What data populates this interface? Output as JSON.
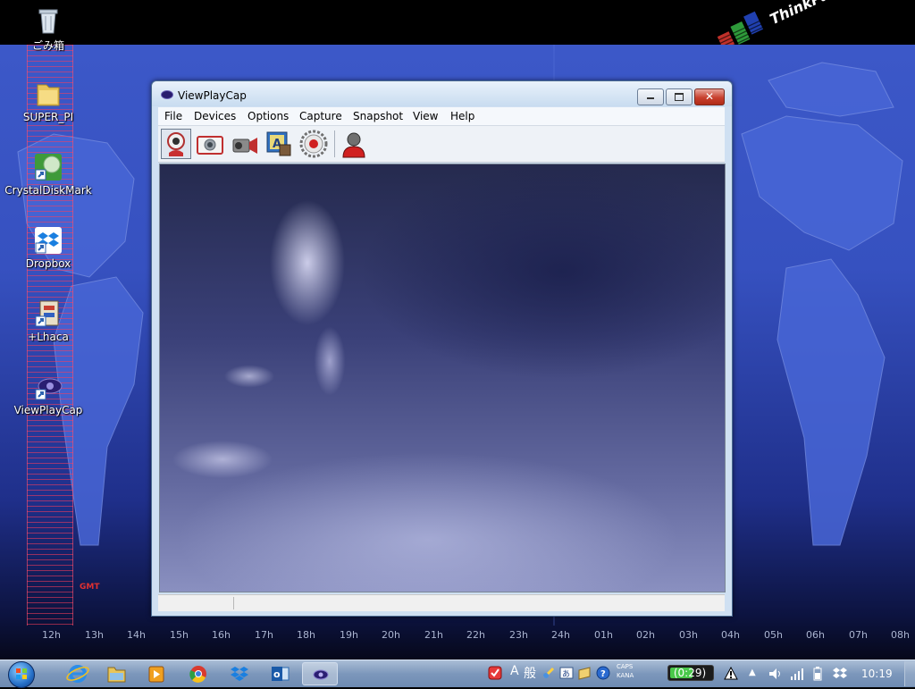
{
  "desktop": {
    "icons": [
      {
        "label": "ごみ箱",
        "icon": "recycle-bin-icon"
      },
      {
        "label": "SUPER_PI",
        "icon": "folder-icon"
      },
      {
        "label": "CrystalDiskMark",
        "icon": "crystaldiskmark-icon"
      },
      {
        "label": "Dropbox",
        "icon": "dropbox-icon"
      },
      {
        "label": "+Lhaca",
        "icon": "lhaca-icon"
      },
      {
        "label": "ViewPlayCap",
        "icon": "viewplaycap-icon"
      }
    ],
    "logo_text": "ThinkPad",
    "gmt_label": "GMT",
    "hours": [
      "12h",
      "13h",
      "14h",
      "15h",
      "16h",
      "17h",
      "18h",
      "19h",
      "20h",
      "21h",
      "22h",
      "23h",
      "24h",
      "01h",
      "02h",
      "03h",
      "04h",
      "05h",
      "06h",
      "07h",
      "08h"
    ]
  },
  "window": {
    "title": "ViewPlayCap",
    "menus": [
      "File",
      "Devices",
      "Options",
      "Capture",
      "Snapshot",
      "View",
      "Help"
    ],
    "toolbar": [
      {
        "name": "preview-webcam",
        "icon": "webcam-icon",
        "active": true
      },
      {
        "name": "snapshot-camera",
        "icon": "camera-icon",
        "active": false
      },
      {
        "name": "video-capture",
        "icon": "camcorder-icon",
        "active": false
      },
      {
        "name": "image-settings",
        "icon": "display-settings-icon",
        "active": false
      },
      {
        "name": "record",
        "icon": "record-icon",
        "active": false
      },
      {
        "name": "user",
        "icon": "user-icon",
        "active": false
      }
    ],
    "statusbar": {
      "left": "",
      "right": ""
    }
  },
  "taskbar": {
    "pinned": [
      "start-button",
      "internet-explorer",
      "windows-explorer",
      "media-player",
      "chrome",
      "dropbox",
      "outlook",
      "viewplaycap"
    ],
    "tray": {
      "ime_mode": "A",
      "ime_text": "般",
      "caps": "CAPS",
      "kana": "KANA",
      "battery": "(0:29)",
      "battery_level": 0.55,
      "clock": "10:19"
    }
  },
  "colors": {
    "accent_blue": "#3c58c8",
    "window_frame": "#cfe0f2",
    "close_red": "#c8402e",
    "gmt_red": "#e03030"
  }
}
